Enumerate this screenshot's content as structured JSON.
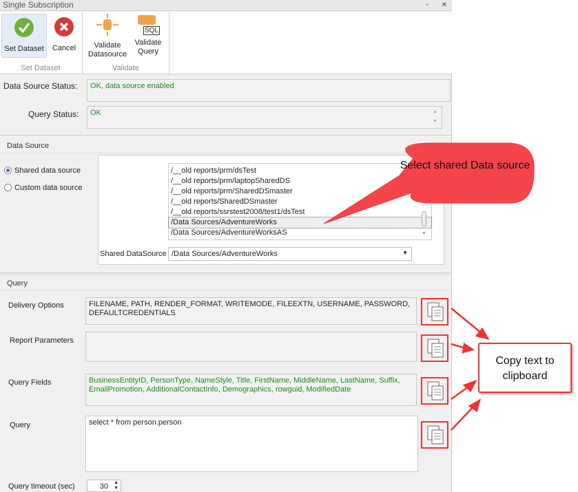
{
  "window": {
    "title": "Single Subscription"
  },
  "ribbon": {
    "set_dataset": "Set Dataset",
    "cancel": "Cancel",
    "group_set": "Set Dataset",
    "validate_datasource": [
      "Validate",
      "Datasource"
    ],
    "validate_query": [
      "Validate",
      "Query"
    ],
    "group_validate": "Validate",
    "sql_badge": "SQL"
  },
  "status": {
    "ds_label": "Data Source Status:",
    "ds_value": "OK, data source enabled",
    "q_label": "Query Status:",
    "q_value": "OK"
  },
  "datasource": {
    "header": "Data Source",
    "shared_radio": "Shared data source",
    "custom_radio": "Custom data source",
    "selected_mode": "shared",
    "items": [
      "/__old reports/prm/dsTest",
      "/__old reports/prm/laptopSharedDS",
      "/__old reports/prm/SharedDSmaster",
      "/__old reports/SharedDSmaster",
      "/__old reports/ssrstest2008/test1/dsTest",
      "/Data Sources/AdventureWorks",
      "/Data Sources/AdventureWorksAS"
    ],
    "selected_index": 5,
    "shared_label": "Shared DataSource",
    "shared_value": "/Data Sources/AdventureWorks"
  },
  "query": {
    "header": "Query",
    "delivery_label": "Delivery Options",
    "delivery_value": "FILENAME, PATH, RENDER_FORMAT, WRITEMODE, FILEEXTN, USERNAME, PASSWORD, DEFAULTCREDENTIALS",
    "params_label": "Report Parameters",
    "params_value": "",
    "fields_label": "Query Fields",
    "fields_value": "BusinessEntityID, PersonType, NameStyle, Title, FirstName, MiddleName, LastName, Suffix, EmailPromotion, AdditionalContactInfo, Demographics, rowguid, ModifiedDate",
    "query_label": "Query",
    "query_value": "select * from person.person",
    "timeout_label": "Query timeout (sec)",
    "timeout_value": "30"
  },
  "callouts": {
    "select": "Select shared Data source",
    "copy": "Copy text to clipboard"
  },
  "colors": {
    "callout_red": "#f5454a",
    "status_green": "#1a8a1a"
  }
}
